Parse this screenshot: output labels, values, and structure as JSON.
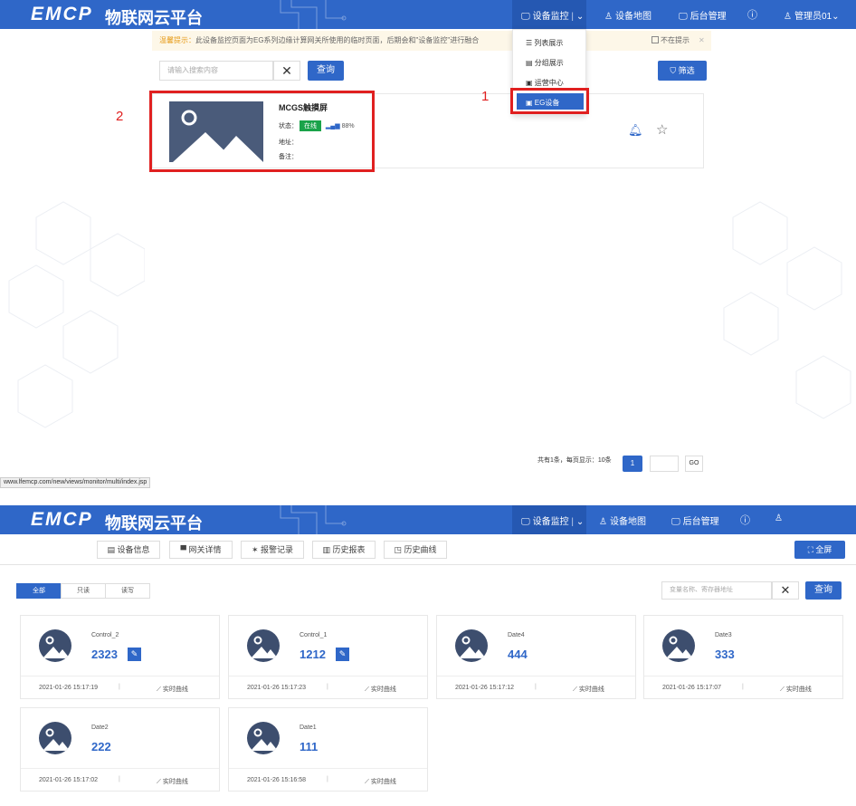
{
  "top": {
    "logo": "EMCP",
    "logo_cn": "物联网云平台",
    "nav": {
      "monitor": "设备监控",
      "map": "设备地图",
      "admin": "后台管理",
      "user": "管理员01"
    },
    "notice": {
      "prefix": "温馨提示：",
      "text": "此设备监控页面为EG系列边缘计算网关所使用的临时页面，后期会和\"设备监控\"进行融合",
      "dont_remind": "不在提示"
    },
    "search": {
      "placeholder": "请输入搜索内容",
      "query_btn": "查询",
      "filter_btn": "筛选"
    },
    "dropdown": [
      "列表展示",
      "分组展示",
      "运营中心",
      "EG设备"
    ],
    "device": {
      "name": "MCGS触摸屏",
      "status_label": "状态：",
      "status": "在线",
      "signal": "88%",
      "address_label": "地址：",
      "note_label": "备注："
    },
    "annotations": {
      "one": "1",
      "two": "2"
    },
    "pager": {
      "summary": "共有1条，每页显示：10条",
      "page": "1",
      "go": "GO"
    },
    "status_url": "www.lfemcp.com/new/views/monitor/multi/index.jsp"
  },
  "bottom": {
    "logo": "EMCP",
    "logo_cn": "物联网云平台",
    "nav": {
      "monitor": "设备监控",
      "map": "设备地图",
      "admin": "后台管理"
    },
    "tabs": [
      "设备信息",
      "网关详情",
      "报警记录",
      "历史报表",
      "历史曲线"
    ],
    "fullscreen": "全屏",
    "filters": [
      "全部",
      "只读",
      "读写"
    ],
    "search_placeholder": "变量名称、寄存器地址",
    "query_btn": "查询",
    "curve_label": "实时曲线",
    "cards": [
      {
        "name": "Control_2",
        "value": "2323",
        "time": "2021-01-26 15:17:19",
        "editable": true
      },
      {
        "name": "Control_1",
        "value": "1212",
        "time": "2021-01-26 15:17:23",
        "editable": true
      },
      {
        "name": "Date4",
        "value": "444",
        "time": "2021-01-26 15:17:12",
        "editable": false
      },
      {
        "name": "Date3",
        "value": "333",
        "time": "2021-01-26 15:17:07",
        "editable": false
      },
      {
        "name": "Date2",
        "value": "222",
        "time": "2021-01-26 15:17:02",
        "editable": false
      },
      {
        "name": "Date1",
        "value": "111",
        "time": "2021-01-26 15:16:58",
        "editable": false
      }
    ]
  },
  "colors": {
    "primary": "#2f67c8",
    "online": "#1aa34a",
    "annotation": "#e02020",
    "warning": "#e69b17"
  }
}
